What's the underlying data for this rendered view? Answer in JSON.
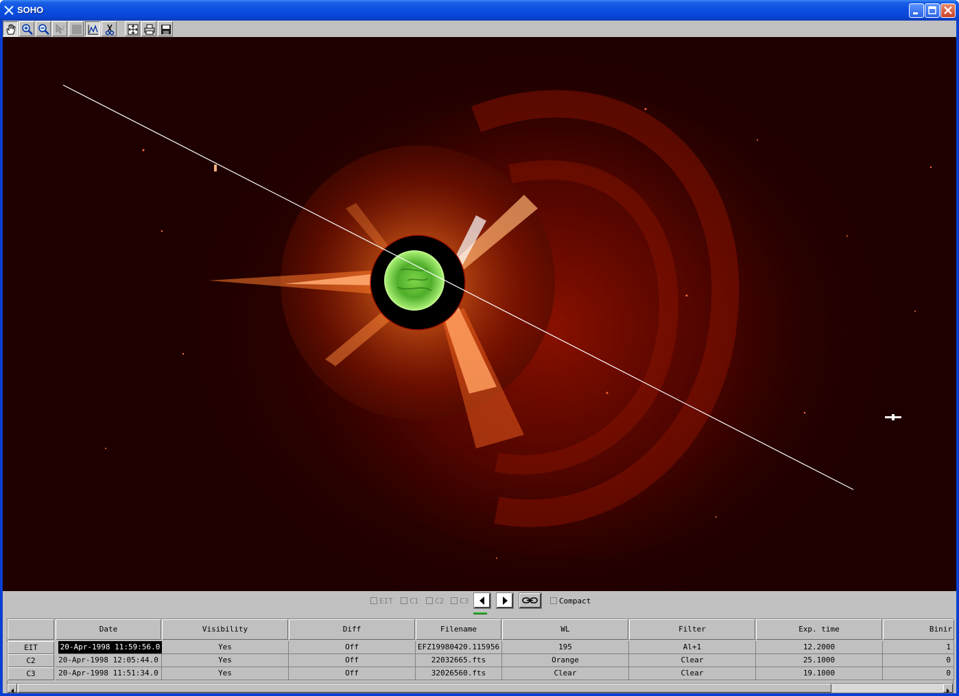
{
  "window": {
    "title": "SOHO"
  },
  "toolbar": {
    "tools": [
      "pan-hand-icon",
      "zoom-in-icon",
      "zoom-out-icon",
      "help-icon",
      "blank-icon",
      "profile-icon",
      "cut-icon",
      "fit-icon",
      "print-icon",
      "save-icon"
    ]
  },
  "controls": {
    "checkboxes": [
      {
        "label": "EIT",
        "checked": false
      },
      {
        "label": "C1",
        "checked": false
      },
      {
        "label": "C2",
        "checked": false
      },
      {
        "label": "C3",
        "checked": false
      }
    ],
    "compact_label": "Compact"
  },
  "table": {
    "columns": [
      "",
      "Date",
      "Visibility",
      "Diff",
      "Filename",
      "WL",
      "Filter",
      "Exp. time",
      "Binir"
    ],
    "rows": [
      {
        "instrument": "EIT",
        "date": "20-Apr-1998 11:59:56.0",
        "visibility": "Yes",
        "diff": "Off",
        "filename": "EFZ19980420.115956",
        "wl": "195",
        "filter": "Al+1",
        "exp_time": "12.2000",
        "bin": "1"
      },
      {
        "instrument": "C2",
        "date": "20-Apr-1998 12:05:44.0",
        "visibility": "Yes",
        "diff": "Off",
        "filename": "22032665.fts",
        "wl": "Orange",
        "filter": "Clear",
        "exp_time": "25.1000",
        "bin": "0"
      },
      {
        "instrument": "C3",
        "date": "20-Apr-1998 11:51:34.0",
        "visibility": "Yes",
        "diff": "Off",
        "filename": "32026560.fts",
        "wl": "Clear",
        "filter": "Clear",
        "exp_time": "19.1000",
        "bin": "0"
      }
    ]
  }
}
